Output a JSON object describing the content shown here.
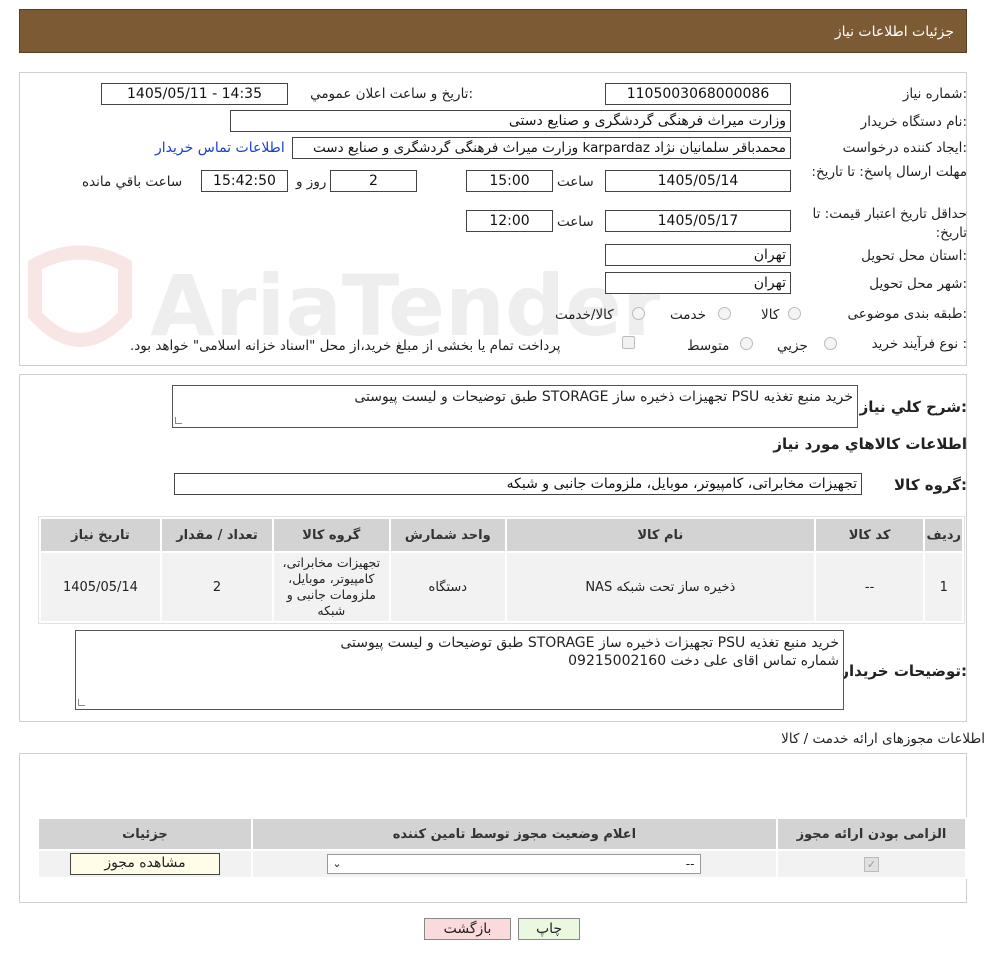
{
  "header": {
    "title": "جزئیات اطلاعات نیاز"
  },
  "watermark": {
    "text": "AriaTender.neT"
  },
  "form": {
    "need_number_label": "شماره نیاز:",
    "need_number": "1105003068000086",
    "announce_label": "تاریخ و ساعت اعلان عمومي:",
    "announce_value": "1405/05/11 - 14:35",
    "buyer_org_label": "نام دستگاه خريدار:",
    "buyer_org": "وزارت میراث فرهنگی  گردشگری و صنایع دستی",
    "requester_label": "ايجاد کننده درخواست:",
    "requester": "محمدباقر سلمانیان نژاد karpardaz وزارت میراث فرهنگی  گردشگری و صنایع دست",
    "contact_link": "اطلاعات تماس خريدار",
    "deadline_label": "مهلت ارسال پاسخ: تا تاریخ:",
    "deadline_date": "1405/05/14",
    "time_label": "ساعت",
    "deadline_time": "15:00",
    "days": "2",
    "days_label": "روز و",
    "remaining": "15:42:50",
    "remaining_label": "ساعت باقي مانده",
    "validity_label": "حداقل تاريخ اعتبار قيمت: تا تاریخ:",
    "validity_date": "1405/05/17",
    "validity_time": "12:00",
    "province_label": "استان محل تحويل:",
    "province": "تهران",
    "city_label": "شهر محل تحويل:",
    "city": "تهران",
    "category_label": "طبقه بندی موضوعی:",
    "category_options": [
      "کالا",
      "خدمت",
      "کالا/خدمت"
    ],
    "process_label": "نوع فرآيند خريد :",
    "process_options": [
      "جزيي",
      "متوسط"
    ],
    "payment_note": "پرداخت تمام يا بخشی از مبلغ خريد،از محل \"اسناد خزانه اسلامی\" خواهد بود."
  },
  "details": {
    "summary_label": "شرح کلي نياز:",
    "summary": "خرید منبع تغذیه PSU تجهیزات ذخیره ساز STORAGE طبق توضیحات و لیست پیوستی",
    "goods_info_title": "اطلاعات کالاهاي مورد نياز",
    "goods_group_label": "گروه کالا:",
    "goods_group": "تجهیزات مخابراتی، کامپیوتر، موبایل، ملزومات جانبی و شبکه",
    "table_headers": [
      "رديف",
      "کد کالا",
      "نام کالا",
      "واحد شمارش",
      "گروه کالا",
      "تعداد / مقدار",
      "تاریخ نیاز"
    ],
    "rows": [
      {
        "index": "1",
        "code": "--",
        "name": "ذخیره ساز تحت شبکه NAS",
        "unit": "دستگاه",
        "group": "تجهیزات مخابراتی، کامپیوتر، موبایل، ملزومات جانبی و شبکه",
        "qty": "2",
        "date": "1405/05/14"
      }
    ],
    "buyer_notes_label": "توضیحات خريدار:",
    "buyer_notes_line1": "خرید منبع تغذیه PSU تجهیزات ذخیره ساز STORAGE طبق توضیحات و لیست پیوستی",
    "buyer_notes_line2": "شماره تماس اقای علی دخت 09215002160"
  },
  "permits": {
    "title": "اطلاعات مجوزهای ارائه خدمت / کالا",
    "headers": [
      "الزامی بودن ارائه مجوز",
      "اعلام وضعیت مجوز توسط تامین کننده",
      "جزئیات"
    ],
    "select_value": "--",
    "view_button": "مشاهده مجوز"
  },
  "footer": {
    "print_button": "چاپ",
    "back_button": "بازگشت"
  },
  "colors": {
    "header_bg": "#7b5a34",
    "link": "#1a3fd1",
    "back_btn_bg": "#fadada",
    "print_btn_bg": "#e9f8de"
  }
}
